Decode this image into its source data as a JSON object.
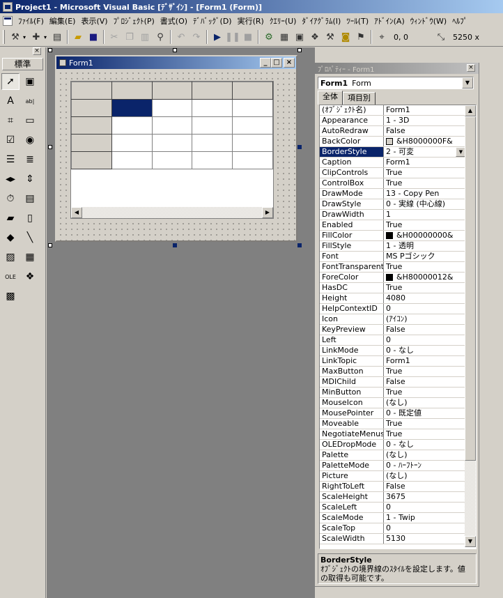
{
  "window": {
    "title": "Project1 - Microsoft Visual Basic [ﾃﾞｻﾞｲﾝ] - [Form1 (Form)]"
  },
  "menu": [
    "ﾌｧｲﾙ(F)",
    "編集(E)",
    "表示(V)",
    "ﾌﾟﾛｼﾞｪｸﾄ(P)",
    "書式(O)",
    "ﾃﾞﾊﾞｯｸﾞ(D)",
    "実行(R)",
    "ｸｴﾘｰ(U)",
    "ﾀﾞｲｱｸﾞﾗﾑ(I)",
    "ﾂｰﾙ(T)",
    "ｱﾄﾞｲﾝ(A)",
    "ｳｨﾝﾄﾞｳ(W)",
    "ﾍﾙﾌﾟ"
  ],
  "toolbar": {
    "position": "0, 0",
    "size": "5250 x"
  },
  "toolbox": {
    "tab_label": "標準",
    "close": "×",
    "tools": [
      {
        "name": "pointer-tool",
        "glyph": "➚"
      },
      {
        "name": "picturebox-tool",
        "glyph": "▣"
      },
      {
        "name": "label-tool",
        "glyph": "A"
      },
      {
        "name": "textbox-tool",
        "glyph": "ab|"
      },
      {
        "name": "frame-tool",
        "glyph": "⌗"
      },
      {
        "name": "commandbutton-tool",
        "glyph": "▭"
      },
      {
        "name": "checkbox-tool",
        "glyph": "☑"
      },
      {
        "name": "optionbutton-tool",
        "glyph": "◉"
      },
      {
        "name": "combobox-tool",
        "glyph": "☰"
      },
      {
        "name": "listbox-tool",
        "glyph": "≣"
      },
      {
        "name": "hscrollbar-tool",
        "glyph": "◂▸"
      },
      {
        "name": "vscrollbar-tool",
        "glyph": "⇕"
      },
      {
        "name": "timer-tool",
        "glyph": "⏱"
      },
      {
        "name": "drivelistbox-tool",
        "glyph": "▤"
      },
      {
        "name": "dirlistbox-tool",
        "glyph": "▰"
      },
      {
        "name": "filelistbox-tool",
        "glyph": "▯"
      },
      {
        "name": "shape-tool",
        "glyph": "◆"
      },
      {
        "name": "line-tool",
        "glyph": "╲"
      },
      {
        "name": "image-tool",
        "glyph": "▨"
      },
      {
        "name": "data-tool",
        "glyph": "▦"
      },
      {
        "name": "ole-tool",
        "glyph": "OLE"
      },
      {
        "name": "activex-tool",
        "glyph": "❖"
      },
      {
        "name": "msflexgrid-tool",
        "glyph": "▩"
      }
    ]
  },
  "form": {
    "title": "Form1",
    "min": "_",
    "max": "□",
    "close": "×"
  },
  "grid": {
    "rows": 5,
    "cols": 5
  },
  "properties": {
    "title": "ﾌﾟﾛﾊﾟﾃｨｰ - Form1",
    "close": "×",
    "object_name": "Form1",
    "object_type": "Form",
    "tabs": [
      "全体",
      "項目別"
    ],
    "selected": "BorderStyle",
    "rows": [
      {
        "name": "(ｵﾌﾞｼﾞｪｸﾄ名)",
        "value": "Form1"
      },
      {
        "name": "Appearance",
        "value": "1 - 3D"
      },
      {
        "name": "AutoRedraw",
        "value": "False"
      },
      {
        "name": "BackColor",
        "value": "&H8000000F&",
        "swatch": "#d4d0c8"
      },
      {
        "name": "BorderStyle",
        "value": "2 - 可変",
        "dropdown": true
      },
      {
        "name": "Caption",
        "value": "Form1"
      },
      {
        "name": "ClipControls",
        "value": "True"
      },
      {
        "name": "ControlBox",
        "value": "True"
      },
      {
        "name": "DrawMode",
        "value": "13 - Copy Pen"
      },
      {
        "name": "DrawStyle",
        "value": "0 - 実線 (中心線)"
      },
      {
        "name": "DrawWidth",
        "value": "1"
      },
      {
        "name": "Enabled",
        "value": "True"
      },
      {
        "name": "FillColor",
        "value": "&H00000000&",
        "swatch": "#000000"
      },
      {
        "name": "FillStyle",
        "value": "1 - 透明"
      },
      {
        "name": "Font",
        "value": "MS Pゴシック"
      },
      {
        "name": "FontTransparent",
        "value": "True"
      },
      {
        "name": "ForeColor",
        "value": "&H80000012&",
        "swatch": "#000000"
      },
      {
        "name": "HasDC",
        "value": "True"
      },
      {
        "name": "Height",
        "value": "4080"
      },
      {
        "name": "HelpContextID",
        "value": "0"
      },
      {
        "name": "Icon",
        "value": "(ｱｲｺﾝ)"
      },
      {
        "name": "KeyPreview",
        "value": "False"
      },
      {
        "name": "Left",
        "value": "0"
      },
      {
        "name": "LinkMode",
        "value": "0 - なし"
      },
      {
        "name": "LinkTopic",
        "value": "Form1"
      },
      {
        "name": "MaxButton",
        "value": "True"
      },
      {
        "name": "MDIChild",
        "value": "False"
      },
      {
        "name": "MinButton",
        "value": "True"
      },
      {
        "name": "MouseIcon",
        "value": "(なし)"
      },
      {
        "name": "MousePointer",
        "value": "0 - 既定値"
      },
      {
        "name": "Moveable",
        "value": "True"
      },
      {
        "name": "NegotiateMenus",
        "value": "True"
      },
      {
        "name": "OLEDropMode",
        "value": "0 - なし"
      },
      {
        "name": "Palette",
        "value": "(なし)"
      },
      {
        "name": "PaletteMode",
        "value": "0 - ﾊｰﾌﾄｰﾝ"
      },
      {
        "name": "Picture",
        "value": "(なし)"
      },
      {
        "name": "RightToLeft",
        "value": "False"
      },
      {
        "name": "ScaleHeight",
        "value": "3675"
      },
      {
        "name": "ScaleLeft",
        "value": "0"
      },
      {
        "name": "ScaleMode",
        "value": "1 - Twip"
      },
      {
        "name": "ScaleTop",
        "value": "0"
      },
      {
        "name": "ScaleWidth",
        "value": "5130"
      }
    ],
    "description_title": "BorderStyle",
    "description_line1": "ｵﾌﾞｼﾞｪｸﾄの境界線のｽﾀｲﾙを設定します。値",
    "description_line2": "の取得も可能です。"
  }
}
